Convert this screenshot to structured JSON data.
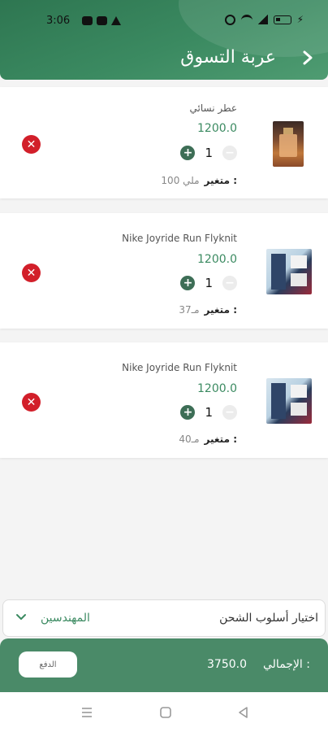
{
  "status_bar": {
    "time": "3:06"
  },
  "header": {
    "title": "عربة التسوق"
  },
  "cart_items": [
    {
      "name": "عطر نسائي",
      "price": "1200.0",
      "quantity": "1",
      "variant_label": "متغير :",
      "variant_value": "100 ملي",
      "plus": "+",
      "minus": "−",
      "remove": "✕"
    },
    {
      "name": "Nike Joyride Run Flyknit",
      "price": "1200.0",
      "quantity": "1",
      "variant_label": "متغير :",
      "variant_value": "37مـ",
      "plus": "+",
      "minus": "−",
      "remove": "✕"
    },
    {
      "name": "Nike Joyride Run Flyknit",
      "price": "1200.0",
      "quantity": "1",
      "variant_label": "متغير :",
      "variant_value": "40مـ",
      "plus": "+",
      "minus": "−",
      "remove": "✕"
    }
  ],
  "shipping": {
    "label": "اختيار أسلوب الشحن",
    "value": "المهندسين"
  },
  "footer": {
    "total_label": "الإجمالي :",
    "total_value": "3750.0",
    "pay_button": "الدفع"
  },
  "colors": {
    "primary": "#3b8a61",
    "remove": "#d21f2a"
  }
}
